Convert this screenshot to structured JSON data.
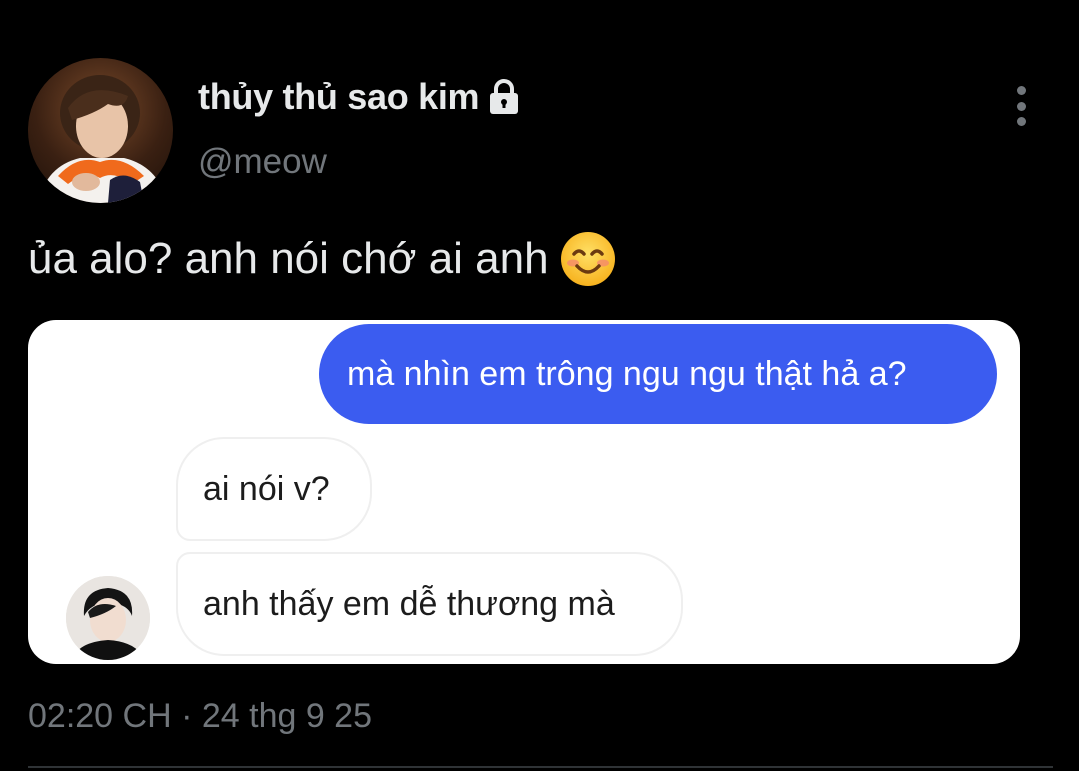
{
  "author": {
    "display_name": "thủy thủ sao kim",
    "handle": "@meow",
    "avatar_icon": "profile-photo",
    "protected_icon": "lock-icon"
  },
  "tweet": {
    "text": "ủa alo? anh nói chớ ai anh",
    "emoji": "😊"
  },
  "media": {
    "messages": [
      {
        "side": "sent",
        "text": "mà nhìn em trông ngu ngu thật hả a?"
      },
      {
        "side": "received",
        "text": "ai nói v?"
      },
      {
        "side": "received",
        "text": "anh thấy em dễ thương mà"
      }
    ],
    "sent_bubble_color": "#3b5cf0"
  },
  "footer": {
    "timestamp": "02:20 CH · 24 thg 9 25"
  },
  "colors": {
    "background": "#000000",
    "primary_text": "#e7e9ea",
    "secondary_text": "#71767b"
  }
}
